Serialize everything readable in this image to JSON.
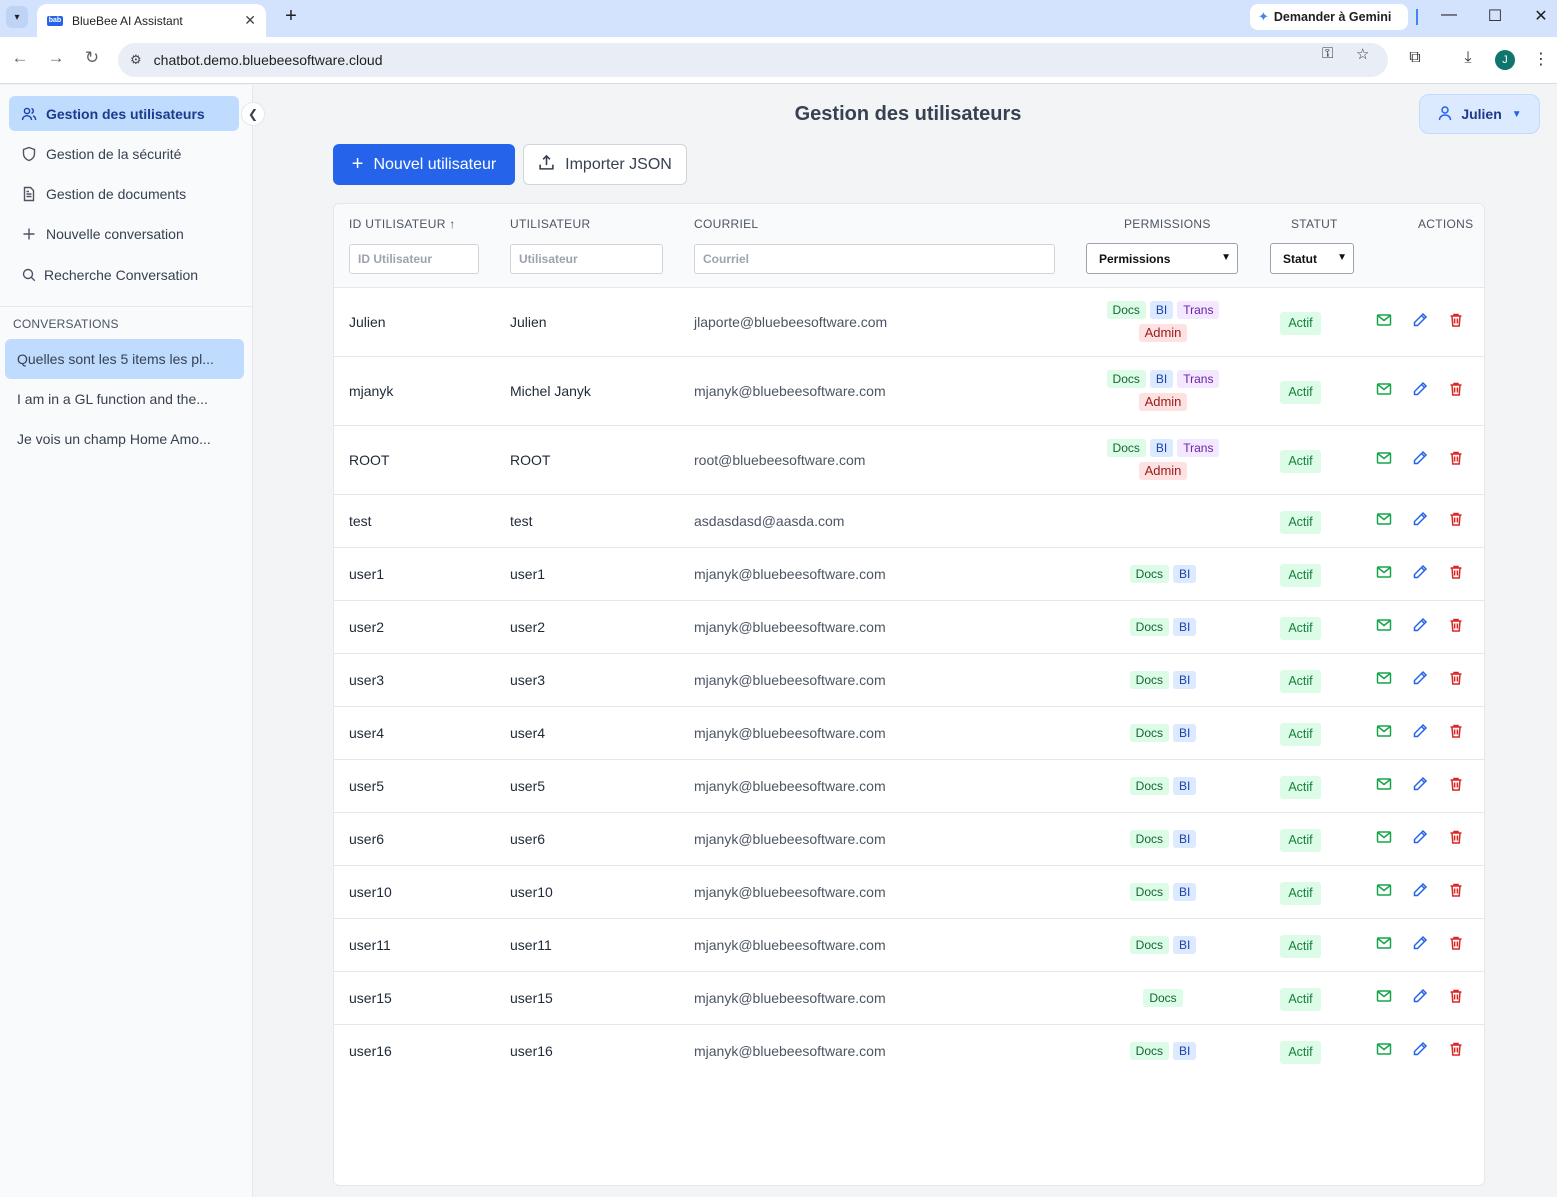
{
  "browser": {
    "tab_title": "BlueBee AI Assistant",
    "favicon_text": "bab",
    "gemini_label": "Demander à Gemini",
    "url": "chatbot.demo.bluebeesoftware.cloud",
    "profile_initial": "J"
  },
  "sidebar": {
    "items": [
      {
        "label": "Gestion des utilisateurs",
        "icon": "users-icon",
        "active": true
      },
      {
        "label": "Gestion de la sécurité",
        "icon": "shield-icon",
        "active": false
      },
      {
        "label": "Gestion de documents",
        "icon": "document-icon",
        "active": false
      },
      {
        "label": "Nouvelle conversation",
        "icon": "plus-icon",
        "active": false
      },
      {
        "label": "Recherche Conversation",
        "icon": "search-icon",
        "active": false
      }
    ],
    "conversations_heading": "CONVERSATIONS",
    "conversations": [
      {
        "label": "Quelles sont les 5 items les pl...",
        "active": true
      },
      {
        "label": "I am in a GL function and the...",
        "active": false
      },
      {
        "label": "Je vois un champ Home Amo...",
        "active": false
      }
    ]
  },
  "header": {
    "title": "Gestion des utilisateurs",
    "user_name": "Julien"
  },
  "actions": {
    "new_user": "Nouvel utilisateur",
    "import_json": "Importer JSON"
  },
  "table": {
    "columns": {
      "id": "ID UTILISATEUR ↑",
      "user": "UTILISATEUR",
      "email": "COURRIEL",
      "permissions": "PERMISSIONS",
      "status": "STATUT",
      "actions": "ACTIONS"
    },
    "filters": {
      "id_placeholder": "ID Utilisateur",
      "user_placeholder": "Utilisateur",
      "email_placeholder": "Courriel",
      "permissions_select": "Permissions",
      "status_select": "Statut"
    },
    "rows": [
      {
        "id": "Julien",
        "user": "Julien",
        "email": "jlaporte@bluebeesoftware.com",
        "permissions": [
          "Docs",
          "BI",
          "Trans",
          "Admin"
        ],
        "status": "Actif"
      },
      {
        "id": "mjanyk",
        "user": "Michel Janyk",
        "email": "mjanyk@bluebeesoftware.com",
        "permissions": [
          "Docs",
          "BI",
          "Trans",
          "Admin"
        ],
        "status": "Actif"
      },
      {
        "id": "ROOT",
        "user": "ROOT",
        "email": "root@bluebeesoftware.com",
        "permissions": [
          "Docs",
          "BI",
          "Trans",
          "Admin"
        ],
        "status": "Actif"
      },
      {
        "id": "test",
        "user": "test",
        "email": "asdasdasd@aasda.com",
        "permissions": [],
        "status": "Actif"
      },
      {
        "id": "user1",
        "user": "user1",
        "email": "mjanyk@bluebeesoftware.com",
        "permissions": [
          "Docs",
          "BI"
        ],
        "status": "Actif"
      },
      {
        "id": "user2",
        "user": "user2",
        "email": "mjanyk@bluebeesoftware.com",
        "permissions": [
          "Docs",
          "BI"
        ],
        "status": "Actif"
      },
      {
        "id": "user3",
        "user": "user3",
        "email": "mjanyk@bluebeesoftware.com",
        "permissions": [
          "Docs",
          "BI"
        ],
        "status": "Actif"
      },
      {
        "id": "user4",
        "user": "user4",
        "email": "mjanyk@bluebeesoftware.com",
        "permissions": [
          "Docs",
          "BI"
        ],
        "status": "Actif"
      },
      {
        "id": "user5",
        "user": "user5",
        "email": "mjanyk@bluebeesoftware.com",
        "permissions": [
          "Docs",
          "BI"
        ],
        "status": "Actif"
      },
      {
        "id": "user6",
        "user": "user6",
        "email": "mjanyk@bluebeesoftware.com",
        "permissions": [
          "Docs",
          "BI"
        ],
        "status": "Actif"
      },
      {
        "id": "user10",
        "user": "user10",
        "email": "mjanyk@bluebeesoftware.com",
        "permissions": [
          "Docs",
          "BI"
        ],
        "status": "Actif"
      },
      {
        "id": "user11",
        "user": "user11",
        "email": "mjanyk@bluebeesoftware.com",
        "permissions": [
          "Docs",
          "BI"
        ],
        "status": "Actif"
      },
      {
        "id": "user15",
        "user": "user15",
        "email": "mjanyk@bluebeesoftware.com",
        "permissions": [
          "Docs"
        ],
        "status": "Actif"
      },
      {
        "id": "user16",
        "user": "user16",
        "email": "mjanyk@bluebeesoftware.com",
        "permissions": [
          "Docs",
          "BI"
        ],
        "status": "Actif"
      }
    ]
  },
  "colors": {
    "primary": "#2563eb",
    "active_nav": "#bfdbfe",
    "status_green": "#15803d",
    "delete_red": "#dc2626"
  }
}
